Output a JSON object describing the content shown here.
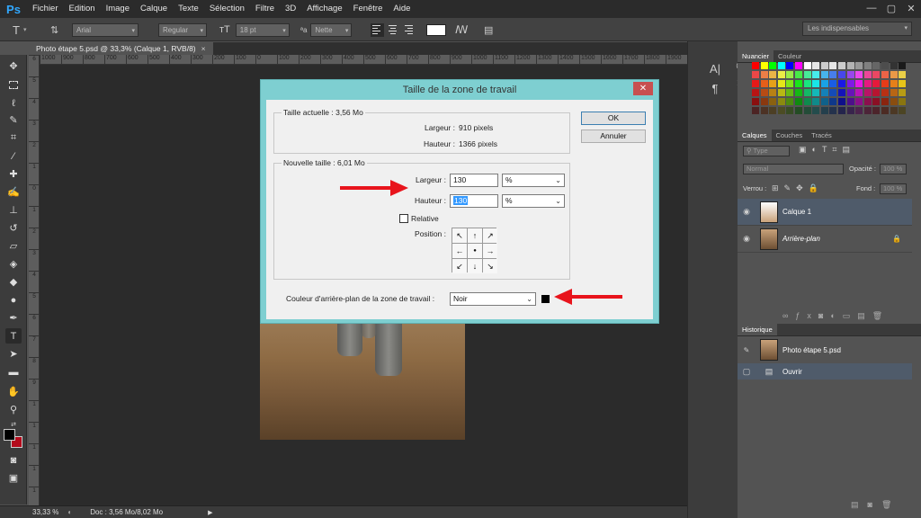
{
  "app": {
    "logo": "Ps",
    "menu": [
      "Fichier",
      "Edition",
      "Image",
      "Calque",
      "Texte",
      "Sélection",
      "Filtre",
      "3D",
      "Affichage",
      "Fenêtre",
      "Aide"
    ],
    "window_controls": [
      "—",
      "▢",
      "✕"
    ]
  },
  "options_bar": {
    "font_family": "Arial",
    "font_style": "Regular",
    "font_size": "18 pt",
    "antialias": "Nette",
    "workspace": "Les indispensables"
  },
  "document": {
    "tab_title": "Photo étape 5.psd @ 33,3% (Calque 1, RVB/8)",
    "tab_close": "×",
    "ruler_top": [
      "1000",
      "900",
      "800",
      "700",
      "600",
      "500",
      "400",
      "300",
      "200",
      "100",
      "0",
      "100",
      "200",
      "300",
      "400",
      "500",
      "600",
      "700",
      "800",
      "900",
      "1000",
      "1100",
      "1200",
      "1300",
      "1400",
      "1500",
      "1600",
      "1700",
      "1800",
      "1900"
    ],
    "ruler_left": [
      "6",
      "5",
      "4",
      "3",
      "2",
      "1",
      "0",
      "1",
      "2",
      "3",
      "4",
      "5",
      "6",
      "7",
      "8",
      "9",
      "1",
      "1",
      "1",
      "1",
      "1"
    ]
  },
  "status": {
    "zoom": "33,33 %",
    "doc_info": "Doc : 3,56 Mo/8,02 Mo",
    "arrow": "▶"
  },
  "panels": {
    "swatch_tabs": [
      "Nuancier",
      "Couleur"
    ],
    "layers_tabs": [
      "Calques",
      "Couches",
      "Tracés"
    ],
    "layers_filter": "Type",
    "blend_mode": "Normal",
    "opacity_label": "Opacité :",
    "opacity_value": "100 %",
    "lock_label": "Verrou :",
    "fill_label": "Fond :",
    "fill_value": "100 %",
    "layers": [
      {
        "name": "Calque 1",
        "selected": true
      },
      {
        "name": "Arrière-plan",
        "selected": false
      }
    ],
    "history_tab": "Historique",
    "history": [
      {
        "name": "Photo étape 5.psd"
      },
      {
        "name": "Ouvrir"
      }
    ]
  },
  "dialog": {
    "title": "Taille de la zone de travail",
    "close": "✕",
    "current_size_legend": "Taille actuelle : 3,56 Mo",
    "current_width_label": "Largeur :",
    "current_width_value": "910 pixels",
    "current_height_label": "Hauteur :",
    "current_height_value": "1366 pixels",
    "new_size_legend": "Nouvelle taille : 6,01 Mo",
    "width_label": "Largeur :",
    "width_value": "130",
    "width_unit": "%",
    "height_label": "Hauteur :",
    "height_value": "130",
    "height_unit": "%",
    "relative_label": "Relative",
    "position_label": "Position :",
    "anchor_arrows": [
      "↖",
      "↑",
      "↗",
      "←",
      "●",
      "→",
      "↙",
      "↓",
      "↘"
    ],
    "bg_color_label": "Couleur d'arrière-plan de la zone de travail :",
    "bg_color_value": "Noir",
    "ok_label": "OK",
    "cancel_label": "Annuler"
  },
  "colors": {
    "accent_red": "#e8141c",
    "dialog_frame": "#7ecfd1",
    "foreground": "#000000",
    "background": "#b40b1c"
  }
}
